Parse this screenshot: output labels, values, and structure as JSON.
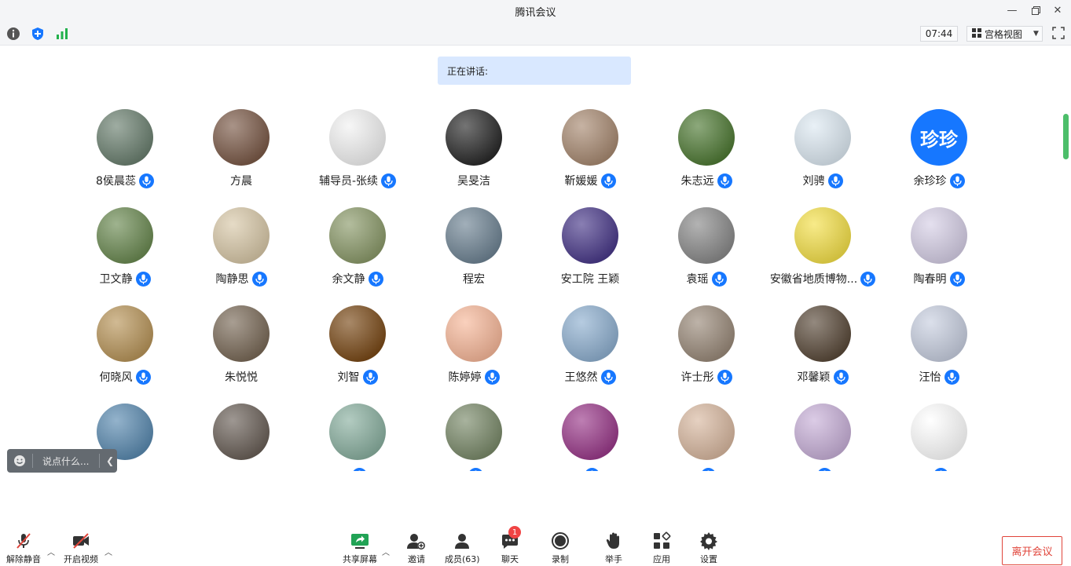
{
  "window": {
    "title": "腾讯会议"
  },
  "topbar": {
    "time": "07:44",
    "view_mode": "宫格视图"
  },
  "speaking_banner": {
    "label": "正在讲话:"
  },
  "chat_input": {
    "placeholder": "说点什么..."
  },
  "participants": [
    {
      "name": "8侯晨蕊",
      "mic": true,
      "color": "#6b8070"
    },
    {
      "name": "方晨",
      "mic": false,
      "color": "#7b5a48"
    },
    {
      "name": "辅导员-张续",
      "mic": true,
      "color": "#f2f2f2",
      "text_avatar": ""
    },
    {
      "name": "吴旻洁",
      "mic": false,
      "color": "#2a2a2a"
    },
    {
      "name": "靳媛媛",
      "mic": true,
      "color": "#a88a72"
    },
    {
      "name": "朱志远",
      "mic": true,
      "color": "#4f7a35"
    },
    {
      "name": "刘骋",
      "mic": true,
      "color": "#dde9f2"
    },
    {
      "name": "余珍珍",
      "mic": true,
      "color": "#1677ff",
      "text_avatar": "珍珍"
    },
    {
      "name": "卫文静",
      "mic": true,
      "color": "#6b8a52"
    },
    {
      "name": "陶静思",
      "mic": true,
      "color": "#d8c8a8"
    },
    {
      "name": "余文静",
      "mic": true,
      "color": "#8b9a6a"
    },
    {
      "name": "程宏",
      "mic": false,
      "color": "#6f8494"
    },
    {
      "name": "安工院  王颖",
      "mic": false,
      "color": "#4a3a8a"
    },
    {
      "name": "袁瑶",
      "mic": true,
      "color": "#8a8a8a"
    },
    {
      "name": "安徽省地质博物...",
      "mic": true,
      "color": "#f4e04a"
    },
    {
      "name": "陶春明",
      "mic": true,
      "color": "#d6cfe6"
    },
    {
      "name": "何晓风",
      "mic": true,
      "color": "#b8955a"
    },
    {
      "name": "朱悦悦",
      "mic": false,
      "color": "#7a6a58"
    },
    {
      "name": "刘智",
      "mic": true,
      "color": "#7a4a18"
    },
    {
      "name": "陈婷婷",
      "mic": true,
      "color": "#f7b89a"
    },
    {
      "name": "王悠然",
      "mic": true,
      "color": "#8fb0d0"
    },
    {
      "name": "许士彤",
      "mic": true,
      "color": "#9a8a7a"
    },
    {
      "name": "邓馨颖",
      "mic": true,
      "color": "#5a4a3a"
    },
    {
      "name": "汪怡",
      "mic": true,
      "color": "#c8cfe0"
    },
    {
      "name": "",
      "mic": false,
      "color": "#5a8ab0"
    },
    {
      "name": "",
      "mic": false,
      "color": "#6a6058"
    },
    {
      "name": "",
      "mic": true,
      "color": "#8ab0a0"
    },
    {
      "name": "",
      "mic": true,
      "color": "#7a8a6a"
    },
    {
      "name": "",
      "mic": true,
      "color": "#9a3a8a"
    },
    {
      "name": "",
      "mic": true,
      "color": "#d8b8a0"
    },
    {
      "name": "",
      "mic": true,
      "color": "#c8b0d8"
    },
    {
      "name": "",
      "mic": true,
      "color": "#ffffff"
    }
  ],
  "bottom": {
    "unmute": "解除静音",
    "video": "开启视频",
    "share": "共享屏幕",
    "invite": "邀请",
    "members": "成员(63)",
    "chat": "聊天",
    "chat_badge": "1",
    "record": "录制",
    "raise_hand": "举手",
    "apps": "应用",
    "settings": "设置",
    "leave": "离开会议"
  }
}
